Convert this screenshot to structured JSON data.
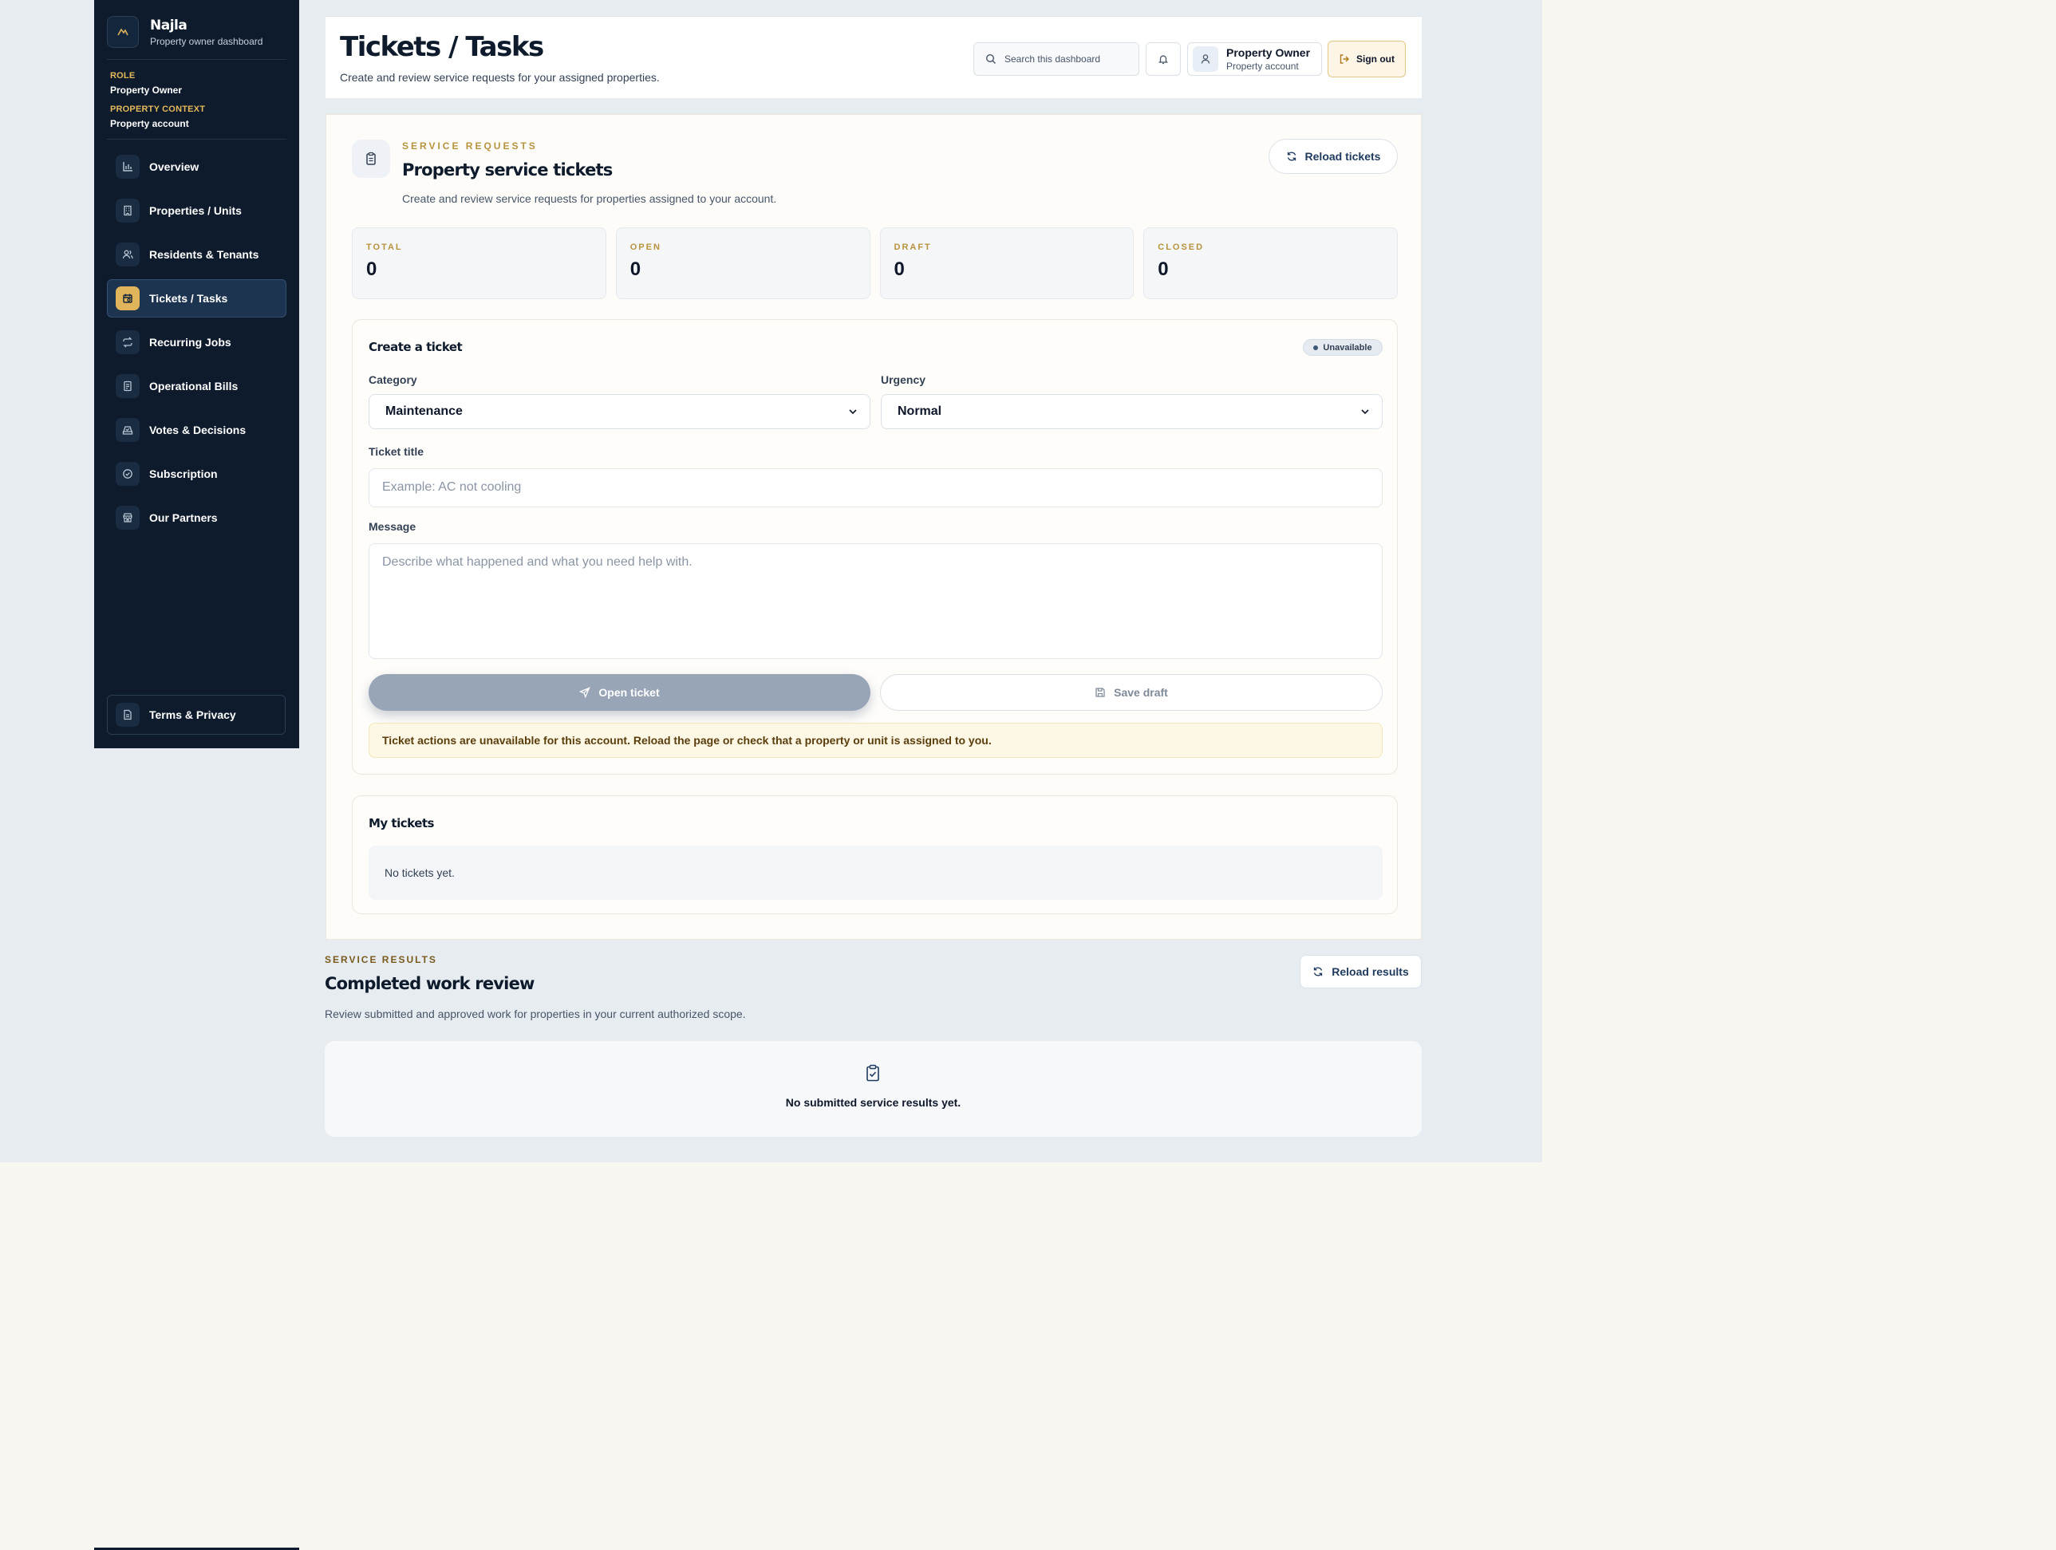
{
  "sidebar": {
    "brand_name": "Najla",
    "brand_sub": "Property owner dashboard",
    "role_label": "ROLE",
    "role_value": "Property Owner",
    "context_label": "PROPERTY CONTEXT",
    "context_value": "Property account",
    "items": [
      {
        "label": "Overview",
        "icon": "chart-icon"
      },
      {
        "label": "Properties / Units",
        "icon": "building-icon"
      },
      {
        "label": "Residents & Tenants",
        "icon": "users-icon"
      },
      {
        "label": "Tickets / Tasks",
        "icon": "ticket-icon",
        "active": true
      },
      {
        "label": "Recurring Jobs",
        "icon": "repeat-icon"
      },
      {
        "label": "Operational Bills",
        "icon": "receipt-icon"
      },
      {
        "label": "Votes & Decisions",
        "icon": "vote-icon"
      },
      {
        "label": "Subscription",
        "icon": "badge-check-icon"
      },
      {
        "label": "Our Partners",
        "icon": "store-icon"
      }
    ],
    "terms_label": "Terms & Privacy"
  },
  "header": {
    "title": "Tickets / Tasks",
    "subtitle": "Create and review service requests for your assigned properties.",
    "search_placeholder": "Search this dashboard",
    "user_name": "Property Owner",
    "user_role": "Property account",
    "signout_label": "Sign out"
  },
  "service_requests": {
    "eyebrow": "SERVICE REQUESTS",
    "title": "Property service tickets",
    "subtitle": "Create and review service requests for properties assigned to your account.",
    "reload_label": "Reload tickets",
    "stats": [
      {
        "label": "TOTAL",
        "value": "0"
      },
      {
        "label": "OPEN",
        "value": "0"
      },
      {
        "label": "DRAFT",
        "value": "0"
      },
      {
        "label": "CLOSED",
        "value": "0"
      }
    ]
  },
  "create_ticket": {
    "title": "Create a ticket",
    "status_badge": "Unavailable",
    "category_label": "Category",
    "category_value": "Maintenance",
    "urgency_label": "Urgency",
    "urgency_value": "Normal",
    "title_label": "Ticket title",
    "title_placeholder": "Example: AC not cooling",
    "message_label": "Message",
    "message_placeholder": "Describe what happened and what you need help with.",
    "open_label": "Open ticket",
    "draft_label": "Save draft",
    "warning": "Ticket actions are unavailable for this account. Reload the page or check that a property or unit is assigned to you."
  },
  "my_tickets": {
    "title": "My tickets",
    "empty": "No tickets yet."
  },
  "service_results": {
    "eyebrow": "SERVICE RESULTS",
    "title": "Completed work review",
    "subtitle": "Review submitted and approved work for properties in your current authorized scope.",
    "reload_label": "Reload results",
    "empty": "No submitted service results yet."
  },
  "colors": {
    "sidebar_bg": "#0e1b2c",
    "accent_gold": "#e0b45a",
    "page_bg": "#e7ecf0"
  }
}
